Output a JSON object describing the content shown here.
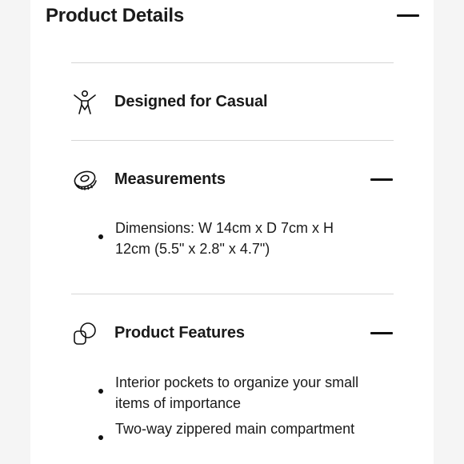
{
  "header": {
    "title": "Product Details"
  },
  "sections": [
    {
      "title": "Designed for Casual",
      "icon": "person-arms-raised-icon"
    },
    {
      "title": "Measurements",
      "icon": "measuring-tape-icon",
      "bullets": [
        "Dimensions: W 14cm x D 7cm x H 12cm (5.5\" x 2.8\" x 4.7\")"
      ]
    },
    {
      "title": "Product Features",
      "icon": "features-shapes-icon",
      "bullets": [
        "Interior pockets to organize your small items of importance",
        "Two-way zippered main compartment"
      ]
    }
  ]
}
